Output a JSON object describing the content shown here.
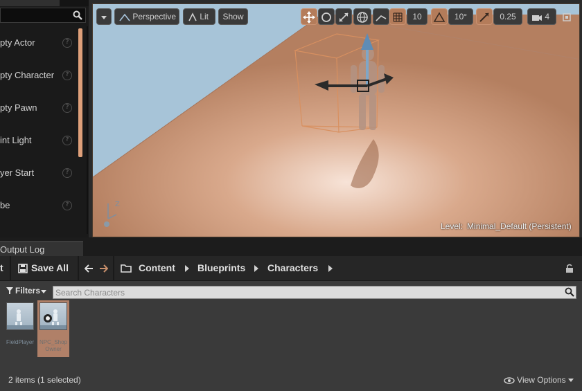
{
  "modes_panel": {
    "items": [
      {
        "label": "pty Actor"
      },
      {
        "label": "pty Character"
      },
      {
        "label": "pty Pawn"
      },
      {
        "label": "int Light"
      },
      {
        "label": "yer Start"
      },
      {
        "label": "be"
      }
    ],
    "help_glyph": "?"
  },
  "viewport": {
    "perspective_label": "Perspective",
    "lit_label": "Lit",
    "show_label": "Show",
    "grid_snap": "10",
    "rotation_snap": "10°",
    "scale_snap": "0.25",
    "camera_speed": "4",
    "level_label": "Level:",
    "level_value": "Minimal_Default (Persistent)"
  },
  "bottom_tab": {
    "label": "Output Log"
  },
  "content_browser": {
    "partial_left": "t",
    "save_all_label": "Save All",
    "breadcrumbs": [
      "Content",
      "Blueprints",
      "Characters"
    ],
    "filters_label": "Filters",
    "search_placeholder": "Search Characters",
    "assets": [
      {
        "name": "FieldPlayer",
        "selected": false
      },
      {
        "name": "NPC_ShopOwner",
        "name_line1": "NPC_Shop",
        "name_line2": "Owner",
        "selected": true
      }
    ],
    "status_text": "2 items (1 selected)",
    "view_options_label": "View Options"
  },
  "colors": {
    "accent": "#b47c5a",
    "sky": "#a7c4d8",
    "floor": "#c8957a"
  }
}
